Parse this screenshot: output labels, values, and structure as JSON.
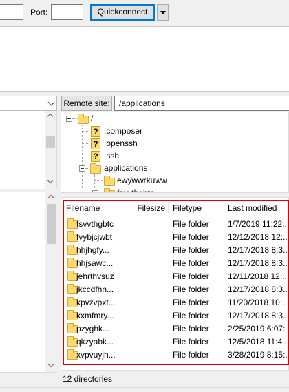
{
  "quickconnect": {
    "port_label": "Port:",
    "host_value": "",
    "port_value": "",
    "button_label": "Quickconnect"
  },
  "local": {
    "site_value": ""
  },
  "remote": {
    "site_label": "Remote site:",
    "site_path": "/applications",
    "tree": [
      {
        "label": "/",
        "icon": "folder-icon",
        "expanded": true
      },
      {
        "label": ".composer",
        "icon": "unknown-folder-icon"
      },
      {
        "label": ".openssh",
        "icon": "unknown-folder-icon"
      },
      {
        "label": ".ssh",
        "icon": "unknown-folder-icon"
      },
      {
        "label": "applications",
        "icon": "folder-icon",
        "expanded": true,
        "selected": true
      },
      {
        "label": "ewywwrkuww",
        "icon": "folder-icon"
      },
      {
        "label": "fsvvthgbtc",
        "icon": "folder-icon",
        "collapsed": true
      }
    ],
    "columns": {
      "filename": "Filename",
      "filesize": "Filesize",
      "filetype": "Filetype",
      "modified": "Last modified"
    },
    "files": [
      {
        "name": "fsvvthgbtc",
        "size": "",
        "type": "File folder",
        "modified": "1/7/2019 11:22:..."
      },
      {
        "name": "fvybjcjwbt",
        "size": "",
        "type": "File folder",
        "modified": "12/12/2018 12:..."
      },
      {
        "name": "hhjhgfy...",
        "size": "",
        "type": "File folder",
        "modified": "12/17/2018 8:3..."
      },
      {
        "name": "hhjsawc...",
        "size": "",
        "type": "File folder",
        "modified": "12/17/2018 8:3..."
      },
      {
        "name": "jehrthvsuz",
        "size": "",
        "type": "File folder",
        "modified": "12/11/2018 12:..."
      },
      {
        "name": "jkccdfhn...",
        "size": "",
        "type": "File folder",
        "modified": "12/17/2018 8:3..."
      },
      {
        "name": "kpvzvpxt...",
        "size": "",
        "type": "File folder",
        "modified": "11/20/2018 10:..."
      },
      {
        "name": "kxmfmry...",
        "size": "",
        "type": "File folder",
        "modified": "12/17/2018 8:3..."
      },
      {
        "name": "pzyghk...",
        "size": "",
        "type": "File folder",
        "modified": "2/25/2019 6:07:..."
      },
      {
        "name": "qkzyabk...",
        "size": "",
        "type": "File folder",
        "modified": "12/5/2018 11:4..."
      },
      {
        "name": "xvpvuyjh...",
        "size": "",
        "type": "File folder",
        "modified": "3/28/2019 8:15:..."
      }
    ],
    "status": "12 directories"
  },
  "colors": {
    "highlight_box": "#e00000",
    "folder": "#ffd96b",
    "focus_border": "#0078d7"
  }
}
